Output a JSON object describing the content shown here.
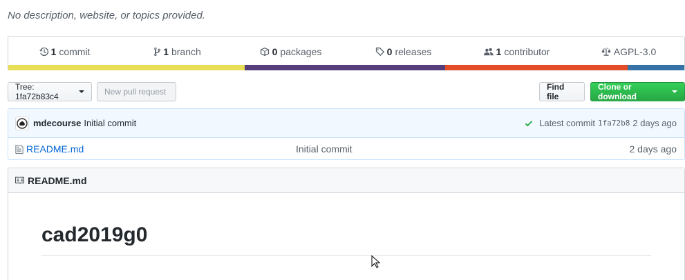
{
  "repo": {
    "description": "No description, website, or topics provided."
  },
  "summary": [
    {
      "icon": "history-icon",
      "count": "1",
      "label": "commit"
    },
    {
      "icon": "branch-icon",
      "count": "1",
      "label": "branch"
    },
    {
      "icon": "package-icon",
      "count": "0",
      "label": "packages"
    },
    {
      "icon": "tag-icon",
      "count": "0",
      "label": "releases"
    },
    {
      "icon": "people-icon",
      "count": "1",
      "label": "contributor"
    },
    {
      "icon": "law-icon",
      "count": "",
      "label": "AGPL-3.0"
    }
  ],
  "language_colors": [
    "#e8df56",
    "#563d7c",
    "#e34c26",
    "#3572a5"
  ],
  "toolbar": {
    "tree_label": "Tree: 1fa72b83c4",
    "new_pr_label": "New pull request",
    "find_file_label": "Find file",
    "clone_label": "Clone or download"
  },
  "commit": {
    "author": "mdecourse",
    "message": "Initial commit",
    "latest_label": "Latest commit",
    "sha": "1fa72b8",
    "age": "2 days ago"
  },
  "files": [
    {
      "name": "README.md",
      "message": "Initial commit",
      "age": "2 days ago"
    }
  ],
  "readme": {
    "header": "README.md",
    "title": "cad2019g0"
  }
}
